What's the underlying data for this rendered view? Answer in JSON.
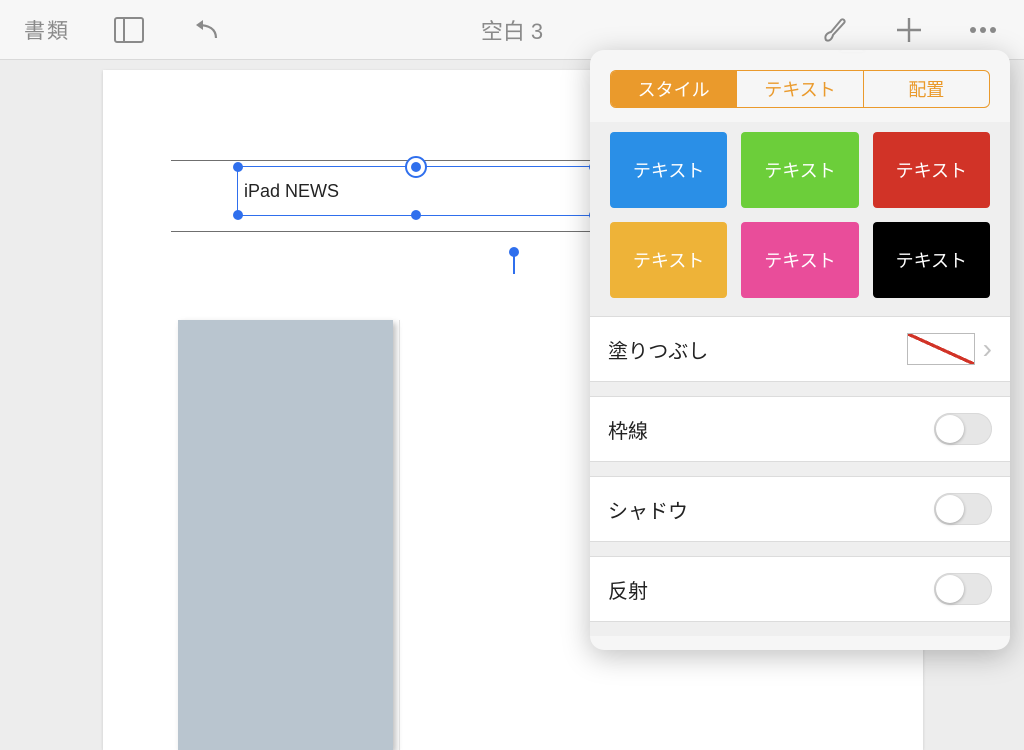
{
  "toolbar": {
    "documents_label": "書類",
    "title": "空白 3"
  },
  "canvas": {
    "textbox_value": "iPad NEWS"
  },
  "popover": {
    "tabs": {
      "style": "スタイル",
      "text": "テキスト",
      "arrange": "配置"
    },
    "swatch_label": "テキスト",
    "fill_label": "塗りつぶし",
    "border_label": "枠線",
    "shadow_label": "シャドウ",
    "reflection_label": "反射"
  }
}
